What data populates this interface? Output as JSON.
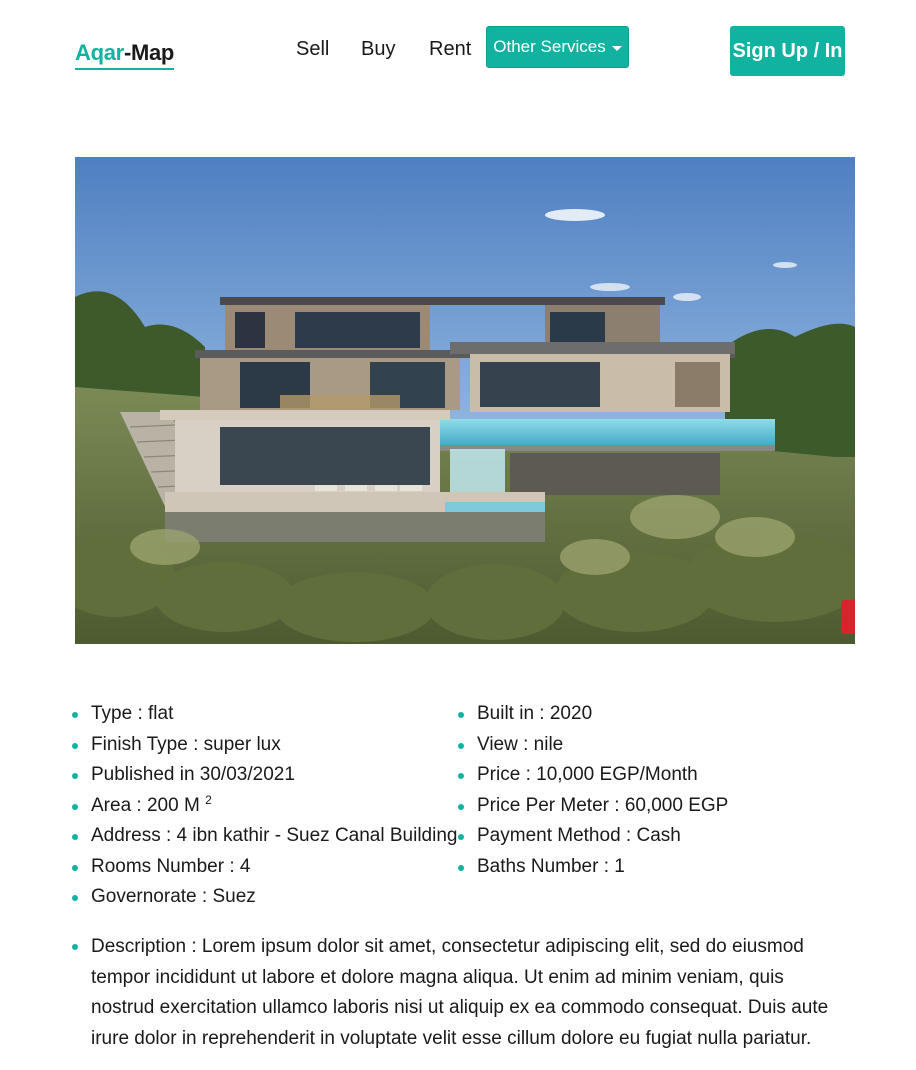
{
  "logo": {
    "accent": "Aqar",
    "rest": "-Map"
  },
  "nav": {
    "sell": "Sell",
    "buy": "Buy",
    "rent": "Rent",
    "other_services": "Other Services",
    "signup": "Sign Up / In"
  },
  "colors": {
    "accent": "#11b3a0",
    "text": "#1a1a1a",
    "background": "#ffffff"
  },
  "hero": {
    "alt_icon": "modern-villa-photo"
  },
  "details_left": {
    "type": "Type : flat",
    "finish": "Finish Type : super lux",
    "published": "Published in 30/03/2021",
    "area": "Area : 200 M",
    "area_sup": "2",
    "address": "Address : 4 ibn kathir - Suez Canal Building",
    "rooms": "Rooms Number : 4",
    "governorate": "Governorate : Suez"
  },
  "details_right": {
    "built": "Built in : 2020",
    "view": "View : nile",
    "price": "Price : 10,000 EGP/Month",
    "price_per_meter": "Price Per Meter : 60,000 EGP",
    "payment": "Payment Method : Cash",
    "baths": "Baths Number : 1"
  },
  "description": "Description : Lorem ipsum dolor sit amet, consectetur adipiscing elit, sed do eiusmod tempor incididunt ut labore et dolore magna aliqua. Ut enim ad minim veniam, quis nostrud exercitation ullamco laboris nisi ut aliquip ex ea commodo consequat. Duis aute irure dolor in reprehenderit in voluptate velit esse cillum dolore eu fugiat nulla pariatur."
}
